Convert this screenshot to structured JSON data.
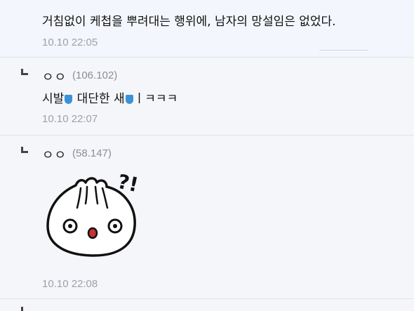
{
  "comments": [
    {
      "text": "거침없이 케첩을 뿌려대는 행위에, 남자의 망설임은 없었다.",
      "time": "10.10 22:05"
    },
    {
      "author": "ㅇㅇ",
      "ip": "(106.102)",
      "text_a": "시발",
      "text_b": " 대단한 새",
      "text_c": "ㅣㅋㅋㅋ",
      "time": "10.10 22:07"
    },
    {
      "author": "ㅇㅇ",
      "ip": "(58.147)",
      "sticker_text": "?!",
      "time": "10.10 22:08"
    }
  ]
}
